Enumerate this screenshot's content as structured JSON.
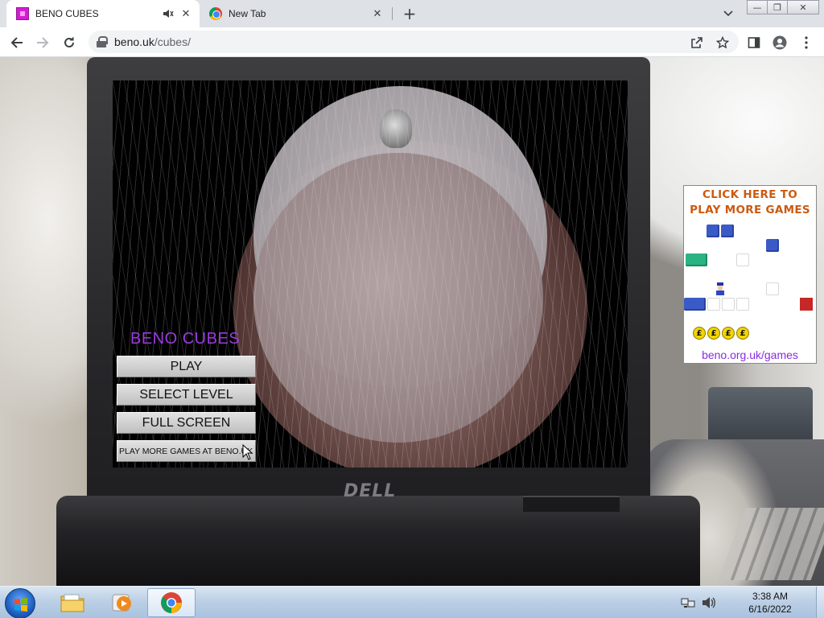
{
  "browser": {
    "tabs": [
      {
        "title": "BENO CUBES",
        "active": true,
        "favicon": "beno-favicon",
        "audio": true
      },
      {
        "title": "New Tab",
        "active": false,
        "favicon": "chrome-favicon"
      }
    ],
    "url_host": "beno.uk",
    "url_path": "/cubes/"
  },
  "game": {
    "title": "BENO CUBES",
    "menu": {
      "play": "PLAY",
      "select_level": "SELECT LEVEL",
      "full_screen": "FULL SCREEN",
      "more_games": "PLAY MORE GAMES AT BENO.UK"
    }
  },
  "ad": {
    "headline_line1": "CLICK HERE TO",
    "headline_line2": "PLAY MORE GAMES",
    "coin_symbol": "£",
    "link": "beno.org.uk/games"
  },
  "laptop_brand": "DELL",
  "taskbar": {
    "time": "3:38 AM",
    "date": "6/16/2022"
  },
  "colors": {
    "game_title": "#9b3ae0",
    "ad_headline": "#cc5a10",
    "ad_link": "#8a2be2"
  }
}
